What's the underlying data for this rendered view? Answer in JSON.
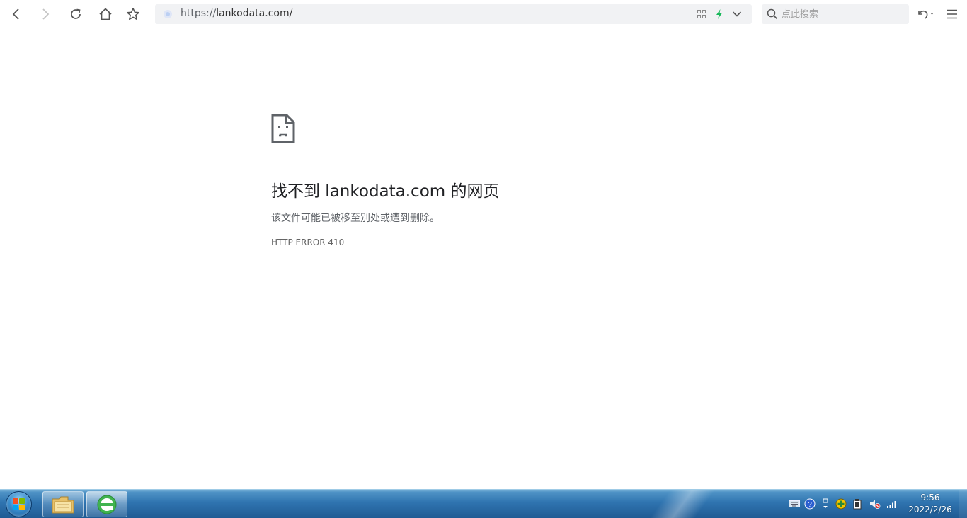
{
  "browser": {
    "address": {
      "url": "https://lankodata.com/"
    },
    "search": {
      "placeholder": "点此搜索"
    },
    "icons": {
      "back": "back-arrow-icon",
      "forward": "forward-arrow-icon",
      "reload": "reload-icon",
      "home": "home-icon",
      "bookmark": "star-icon",
      "qr": "qr-code-icon",
      "speed": "lightning-icon",
      "dropdown": "chevron-down-icon",
      "search": "search-icon",
      "undo": "undo-icon",
      "menu": "hamburger-menu-icon"
    },
    "colors": {
      "lightning": "#18b85a"
    }
  },
  "error_page": {
    "title": "找不到 lankodata.com 的网页",
    "description": "该文件可能已被移至别处或遭到删除。",
    "code": "HTTP ERROR 410"
  },
  "taskbar": {
    "clock": {
      "time": "9:56",
      "date": "2022/2/26"
    },
    "pinned": [
      "file-explorer",
      "browser"
    ]
  }
}
